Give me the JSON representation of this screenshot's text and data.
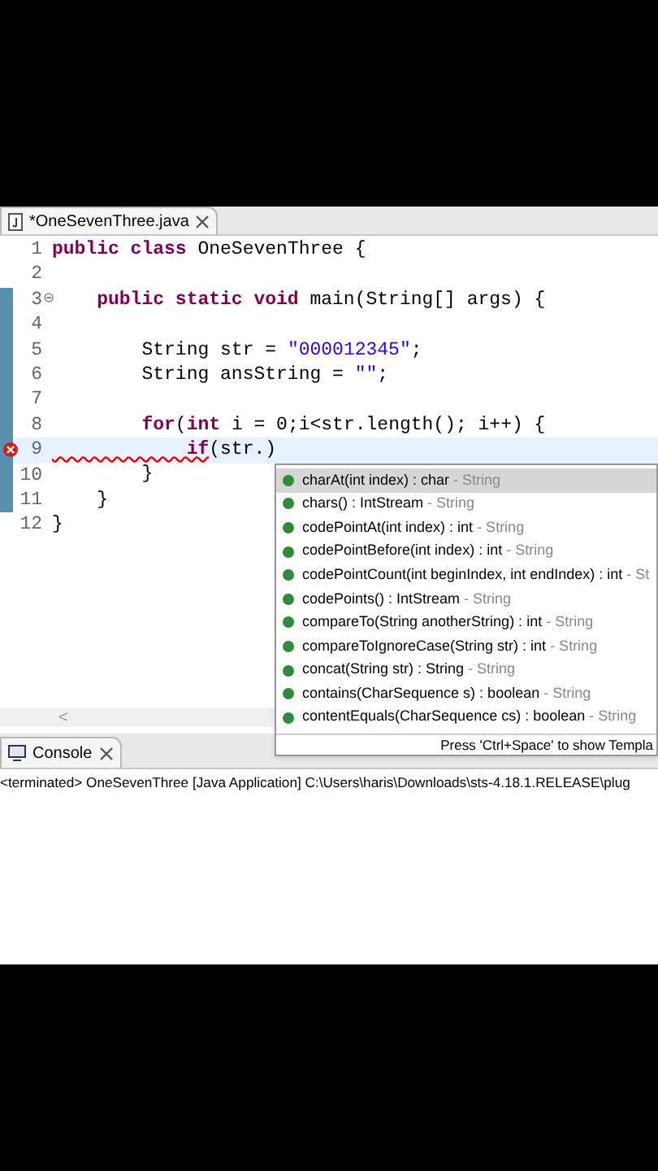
{
  "editor_tab": {
    "title": "*OneSevenThree.java",
    "selected": true
  },
  "code_lines": [
    {
      "number": "1",
      "changed": false,
      "current": false,
      "error": false,
      "fold": false,
      "segments": [
        {
          "kind": "keyword",
          "text": "public class"
        },
        {
          "kind": "plain",
          "text": " OneSevenThree {"
        }
      ]
    },
    {
      "number": "2",
      "changed": false,
      "current": false,
      "error": false,
      "fold": false
    },
    {
      "number": "3",
      "changed": true,
      "current": false,
      "error": false,
      "fold": true,
      "segments": [
        {
          "kind": "keyword",
          "text": "    public static void"
        },
        {
          "kind": "plain",
          "text": " main(String[] args) {"
        }
      ]
    },
    {
      "number": "4",
      "changed": true,
      "current": false,
      "error": false,
      "fold": false
    },
    {
      "number": "5",
      "changed": true,
      "current": false,
      "error": false,
      "fold": false,
      "segments": [
        {
          "kind": "plain",
          "text": "        String str = "
        },
        {
          "kind": "string",
          "text": "\"000012345\""
        },
        {
          "kind": "plain",
          "text": ";"
        }
      ]
    },
    {
      "number": "6",
      "changed": true,
      "current": false,
      "error": false,
      "fold": false,
      "segments": [
        {
          "kind": "plain",
          "text": "        String ansString = "
        },
        {
          "kind": "string",
          "text": "\"\""
        },
        {
          "kind": "plain",
          "text": ";"
        }
      ]
    },
    {
      "number": "7",
      "changed": true,
      "current": false,
      "error": false,
      "fold": false
    },
    {
      "number": "8",
      "changed": true,
      "current": false,
      "error": false,
      "fold": false,
      "segments": [
        {
          "kind": "keyword",
          "text": "        for"
        },
        {
          "kind": "plain",
          "text": "("
        },
        {
          "kind": "keyword",
          "text": "int"
        },
        {
          "kind": "plain",
          "text": " i = 0;i<str.length(); i++) {"
        }
      ]
    },
    {
      "number": "9",
      "changed": true,
      "current": true,
      "error": true,
      "fold": false,
      "segments": [
        {
          "kind": "error",
          "text": "            if"
        },
        {
          "kind": "plain",
          "text": "(str.)"
        }
      ]
    },
    {
      "number": "10",
      "changed": true,
      "current": false,
      "error": false,
      "fold": false,
      "segments": [
        {
          "kind": "plain",
          "text": "        }"
        }
      ]
    },
    {
      "number": "11",
      "changed": true,
      "current": false,
      "error": false,
      "fold": false,
      "segments": [
        {
          "kind": "plain",
          "text": "    }"
        }
      ]
    },
    {
      "number": "12",
      "changed": false,
      "current": false,
      "error": false,
      "fold": false,
      "segments": [
        {
          "kind": "plain",
          "text": "}"
        }
      ]
    }
  ],
  "completion": {
    "items": [
      {
        "signature": "charAt(int index) : char",
        "owner": " - String",
        "selected": true
      },
      {
        "signature": "chars() : IntStream",
        "owner": " - String",
        "selected": false
      },
      {
        "signature": "codePointAt(int index) : int",
        "owner": " - String",
        "selected": false
      },
      {
        "signature": "codePointBefore(int index) : int",
        "owner": " - String",
        "selected": false
      },
      {
        "signature": "codePointCount(int beginIndex, int endIndex) : int",
        "owner": " - St",
        "selected": false
      },
      {
        "signature": "codePoints() : IntStream",
        "owner": " - String",
        "selected": false
      },
      {
        "signature": "compareTo(String anotherString) : int",
        "owner": " - String",
        "selected": false
      },
      {
        "signature": "compareToIgnoreCase(String str) : int",
        "owner": " - String",
        "selected": false
      },
      {
        "signature": "concat(String str) : String",
        "owner": " - String",
        "selected": false
      },
      {
        "signature": "contains(CharSequence s) : boolean",
        "owner": " - String",
        "selected": false
      },
      {
        "signature": "contentEquals(CharSequence cs) : boolean",
        "owner": " - String",
        "selected": false
      }
    ],
    "footer": "Press 'Ctrl+Space' to show Templa"
  },
  "scroll_arrow": "<",
  "console_tab": {
    "title": "Console",
    "selected": true
  },
  "console_line": "<terminated> OneSevenThree [Java Application] C:\\Users\\haris\\Downloads\\sts-4.18.1.RELEASE\\plug"
}
